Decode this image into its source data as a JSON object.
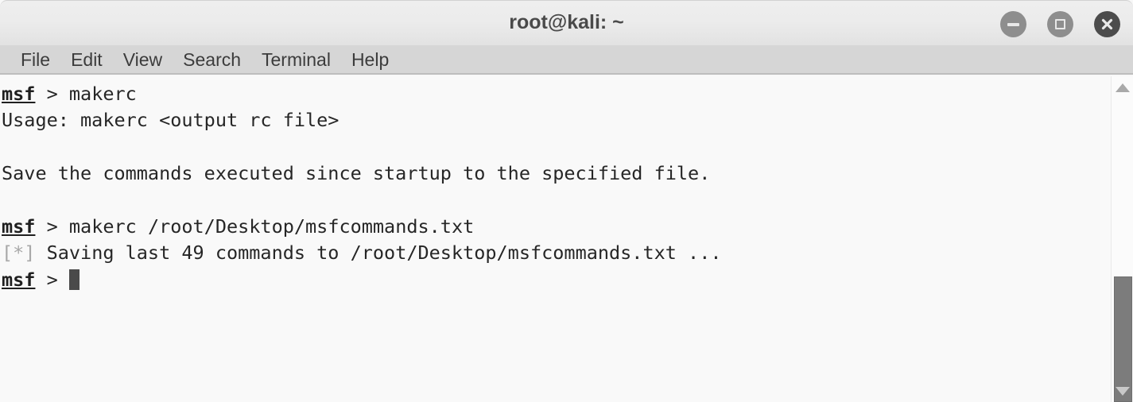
{
  "window": {
    "title": "root@kali: ~",
    "controls": [
      {
        "name": "minimize",
        "icon": "minimize-icon",
        "color": "#8e8e8e"
      },
      {
        "name": "maximize",
        "icon": "maximize-icon",
        "color": "#8e8e8e"
      },
      {
        "name": "close",
        "icon": "close-icon",
        "color": "#4c4c4c"
      }
    ]
  },
  "menubar": {
    "items": [
      {
        "label": "File"
      },
      {
        "label": "Edit"
      },
      {
        "label": "View"
      },
      {
        "label": "Search"
      },
      {
        "label": "Terminal"
      },
      {
        "label": "Help"
      }
    ]
  },
  "terminal": {
    "prompt_symbol": "msf",
    "prompt_separator": " > ",
    "lines": [
      {
        "prompt": "msf",
        "sep": " > ",
        "text": "makerc"
      },
      {
        "text": "Usage: makerc <output rc file>"
      },
      {
        "text": ""
      },
      {
        "text": "Save the commands executed since startup to the specified file."
      },
      {
        "text": ""
      },
      {
        "prompt": "msf",
        "sep": " > ",
        "text": "makerc /root/Desktop/msfcommands.txt"
      },
      {
        "dim": "[*]",
        "text": " Saving last 49 commands to /root/Desktop/msfcommands.txt ..."
      },
      {
        "prompt": "msf",
        "sep": " > ",
        "cursor": true,
        "text": ""
      }
    ],
    "saved_command_count": "49",
    "output_file_path": "/root/Desktop/msfcommands.txt",
    "colors": {
      "background": "#f9f9f9",
      "foreground": "#262626",
      "dim": "#a8a8a8",
      "cursor": "#4a4a4a"
    }
  },
  "scrollbar": {
    "up_arrow": "▲",
    "down_arrow": "▼",
    "thumb_color": "#7c7c7c"
  }
}
